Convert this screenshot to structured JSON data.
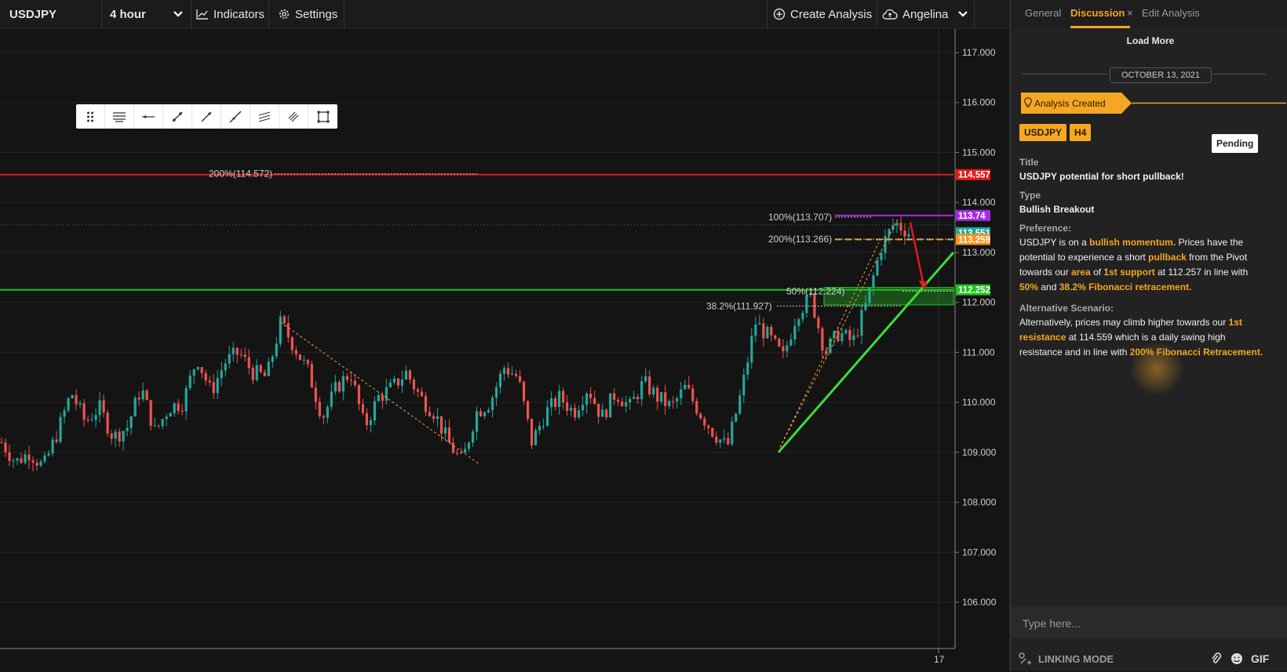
{
  "topbar": {
    "symbol": "USDJPY",
    "interval": "4 hour",
    "indicators_label": "Indicators",
    "settings_label": "Settings",
    "create_label": "Create Analysis",
    "user_name": "Angelina"
  },
  "drawing_tools": [
    "drag-handle-icon",
    "horizontal-lines-icon",
    "horizontal-segment-icon",
    "trend-line-icon",
    "ray-icon",
    "extended-line-icon",
    "parallel-channel-icon",
    "fib-tool-icon",
    "rectangle-icon"
  ],
  "price_axis": {
    "ticks": [
      "117.000",
      "116.000",
      "115.000",
      "114.000",
      "113.000",
      "112.000",
      "111.000",
      "110.000",
      "109.000",
      "108.000",
      "107.000",
      "106.000"
    ],
    "time_label": "17"
  },
  "chart_data": {
    "type": "candlestick",
    "symbol": "USDJPY",
    "ylim": [
      105.2,
      117.4
    ],
    "levels": [
      {
        "price": 114.557,
        "label": "114.557",
        "color": "#e21c1c"
      },
      {
        "price": 113.74,
        "label": "113.74",
        "color": "#a52de0"
      },
      {
        "price": 113.551,
        "label": "113.551",
        "color": "#26a69a"
      },
      {
        "price": 113.259,
        "label": "113.259",
        "color": "#f7931e"
      },
      {
        "price": 112.252,
        "label": "112.252",
        "color": "#22c322"
      }
    ],
    "fib_labels": [
      {
        "text": "200%(114.572)",
        "price": 114.572
      },
      {
        "text": "100%(113.707)",
        "price": 113.707
      },
      {
        "text": "200%(113.266)",
        "price": 113.266
      },
      {
        "text": "50%(112.224)",
        "price": 112.224
      },
      {
        "text": "38.2%(111.927)",
        "price": 111.927
      }
    ],
    "price_path": [
      109.2,
      108.8,
      109.0,
      108.7,
      109.4,
      110.2,
      109.6,
      109.9,
      109.3,
      109.5,
      110.3,
      109.4,
      109.9,
      110.0,
      110.9,
      110.2,
      110.8,
      111.0,
      110.6,
      110.5,
      111.6,
      111.1,
      110.6,
      109.7,
      110.3,
      110.6,
      109.5,
      110.1,
      110.3,
      110.6,
      110.1,
      109.8,
      109.2,
      108.8,
      109.8,
      110.0,
      110.7,
      110.5,
      109.2,
      109.8,
      110.1,
      109.8,
      110.3,
      109.7,
      110.2,
      109.9,
      110.4,
      110.1,
      109.9,
      110.3,
      109.8,
      109.4,
      109.1,
      110.2,
      111.6,
      111.3,
      110.9,
      111.8,
      112.1,
      111.0,
      111.4,
      111.2,
      112.0,
      113.1,
      113.6,
      113.4
    ],
    "trendline": {
      "from": [
        0,
        109.0
      ],
      "to": [
        1,
        113.0
      ]
    },
    "projection_arrow": {
      "from": 113.6,
      "to": 112.25
    }
  },
  "panel": {
    "tabs": [
      "General",
      "Discussion",
      "Edit Analysis"
    ],
    "close_glyph": "×",
    "load_more": "Load More",
    "date": "OCTOBER 13, 2021",
    "created": "Analysis Created",
    "symbol_badge": "USDJPY",
    "tf_badge": "H4",
    "status": "Pending",
    "title_label": "Title",
    "title": "USDJPY potential for short pullback!",
    "type_label": "Type",
    "type": "Bullish Breakout",
    "pref_label": "Preference:",
    "pref_p1": "USDJPY is on a ",
    "pref_h1": "bullish momentum.",
    "pref_p2": " Prices have the potential to experience a short ",
    "pref_h2": "pullback",
    "pref_p3": " from the Pivot towards our ",
    "pref_h3": "area",
    "pref_p4": " of ",
    "pref_h4": "1st support",
    "pref_p5": " at 112.257 in line with ",
    "pref_h5": "50%",
    "pref_p6": " and ",
    "pref_h6": "38.2% Fibonacci retracement.",
    "alt_label": "Alternative Scenario:",
    "alt_p1": "Alternatively, prices may climb higher towards our ",
    "alt_h1": "1st resistance",
    "alt_p2": " at 114.559 which is a daily swing high resistance and in line with ",
    "alt_h2": "200% Fibonacci Retracement.",
    "input_placeholder": "Type here...",
    "linking": "LINKING MODE",
    "gif": "GIF"
  }
}
